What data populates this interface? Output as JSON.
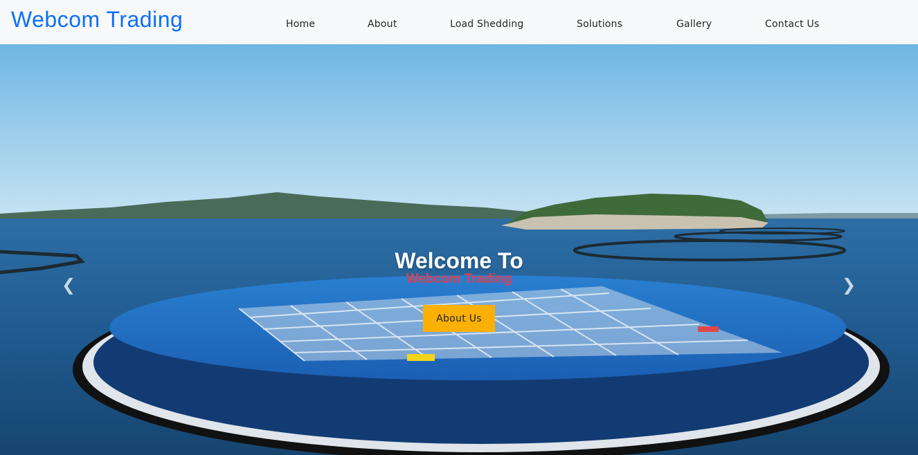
{
  "navbar": {
    "brand": "Webcom Trading",
    "links": [
      {
        "label": "Home"
      },
      {
        "label": "About"
      },
      {
        "label": "Load Shedding"
      },
      {
        "label": "Solutions"
      },
      {
        "label": "Gallery"
      },
      {
        "label": "Contact Us"
      }
    ]
  },
  "hero": {
    "heading": "Welcome To",
    "subheading": "Webcom Trading",
    "button_label": "About Us",
    "prev_icon": "chevron-left-icon",
    "next_icon": "chevron-right-icon"
  },
  "colors": {
    "brand": "#0d6efd",
    "navbar_bg": "#f8f9fa",
    "subheading": "#e0404e",
    "button_bg": "#fab005"
  }
}
